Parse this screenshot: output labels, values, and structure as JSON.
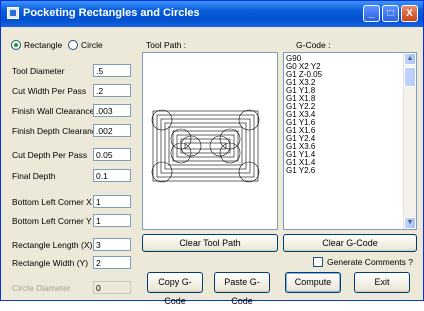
{
  "window": {
    "title": "Pocketing Rectangles and Circles",
    "min": "_",
    "max": "□",
    "close": "X"
  },
  "shape": {
    "rectangle_label": "Rectangle",
    "circle_label": "Circle",
    "selected": "rectangle"
  },
  "params": [
    {
      "label": "Tool Diameter",
      "value": ".5"
    },
    {
      "label": "Cut Width Per Pass",
      "value": ".2"
    },
    {
      "label": "Finish Wall Clearance",
      "value": ".003"
    },
    {
      "label": "Finish Depth Clearance",
      "value": ".002"
    },
    {
      "label": "Cut Depth Per Pass",
      "value": "0.05"
    },
    {
      "label": "Final Depth",
      "value": "0.1"
    },
    {
      "label": "Bottom Left Corner X",
      "value": "1"
    },
    {
      "label": "Bottom Left Corner Y",
      "value": "1"
    },
    {
      "label": "Rectangle Length (X)",
      "value": "3"
    },
    {
      "label": "Rectangle Width (Y)",
      "value": "2"
    },
    {
      "label": "Circle Diameter",
      "value": "0"
    }
  ],
  "toolpath": {
    "label": "Tool Path :",
    "clear_button": "Clear Tool Path"
  },
  "gcode": {
    "label": "G-Code :",
    "lines": [
      "G90",
      "G0 X2 Y2",
      "G1 Z-0.05",
      "G1 X3.2",
      "G1 Y1.8",
      "G1 X1.8",
      "G1 Y2.2",
      "G1 X3.4",
      "G1 Y1.6",
      "G1 X1.6",
      "G1 Y2.4",
      "G1 X3.6",
      "G1 Y1.4",
      "G1 X1.4",
      "G1 Y2.6"
    ],
    "clear_button": "Clear G-Code",
    "comments_label": "Generate Comments ?"
  },
  "actions": {
    "copy": "Copy G-Code",
    "paste": "Paste G-Code",
    "compute": "Compute",
    "exit": "Exit"
  }
}
